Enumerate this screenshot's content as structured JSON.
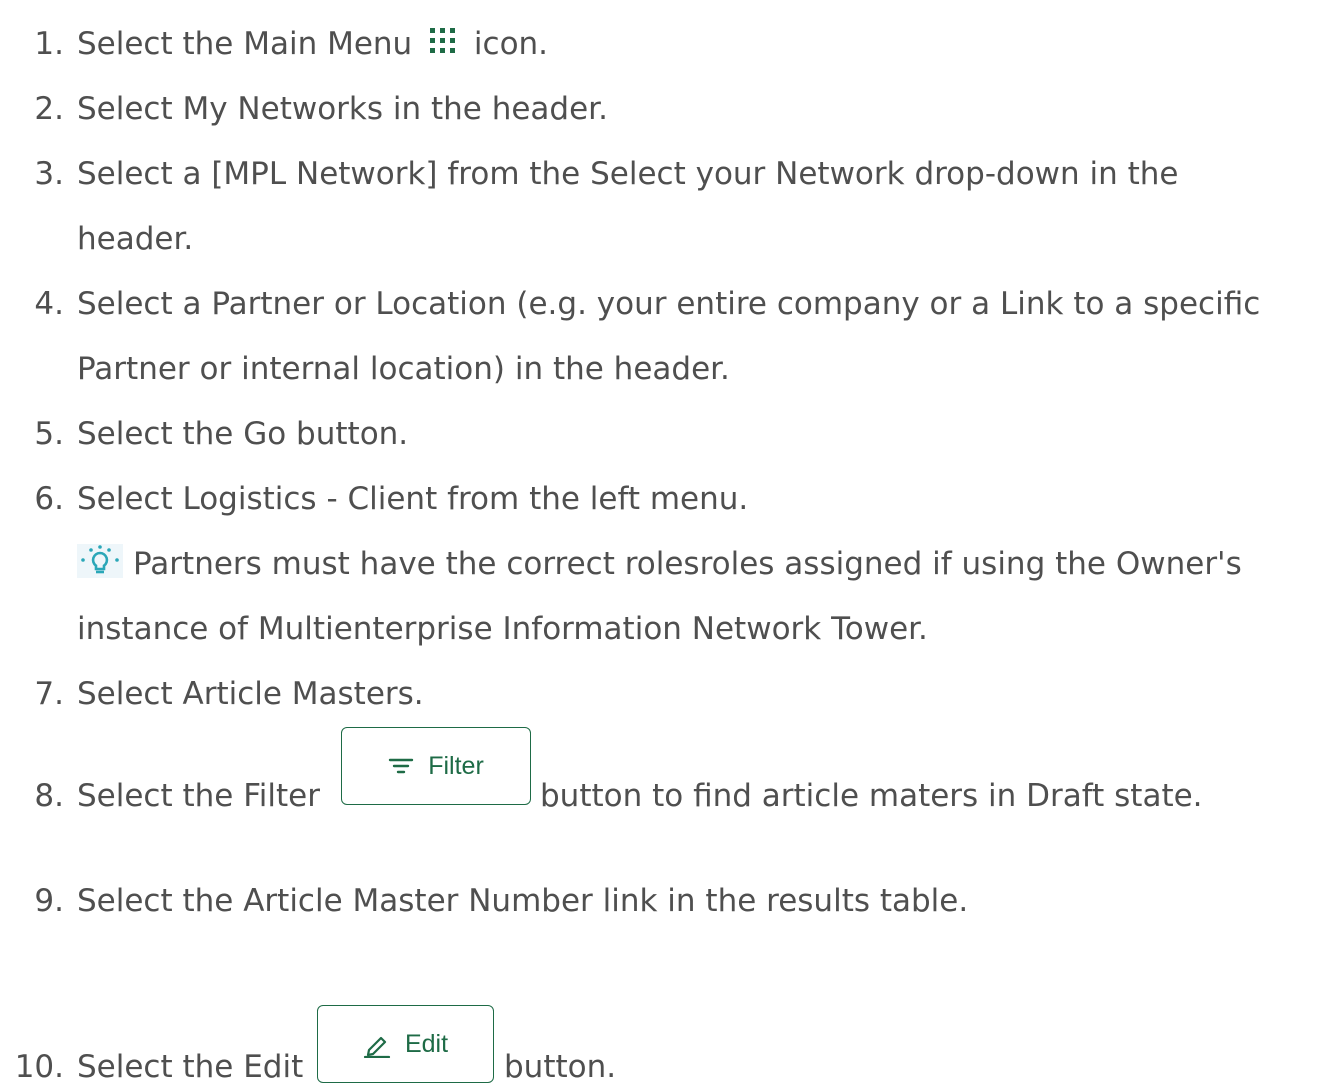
{
  "steps": [
    {
      "number": "1.",
      "before": "Select the Main Menu",
      "after": "icon.",
      "icon": "grid-dots-icon"
    },
    {
      "number": "2.",
      "text": "Select My Networks in the header."
    },
    {
      "number": "3.",
      "line1": "Select a [MPL Network] from the Select your Network drop-down in the",
      "line2": "header."
    },
    {
      "number": "4.",
      "line1": "Select a Partner or Location (e.g. your entire company or a Link to a specific",
      "line2": "Partner or internal location) in the header."
    },
    {
      "number": "5.",
      "text": "Select the Go button."
    },
    {
      "number": "6.",
      "text": " Select Logistics - Client from the left menu."
    },
    {
      "number": "7.",
      "text": "Select Article Masters."
    },
    {
      "number": "8.",
      "before": "Select the Filter",
      "after": "button to find article maters in Draft state.",
      "button_label": "Filter",
      "button_icon": "filter-lines-icon"
    },
    {
      "number": "9.",
      "text": "Select the Article Master Number link in the results table."
    },
    {
      "number": "10.",
      "before": "Select the Edit",
      "after": "button.",
      "button_label": "Edit",
      "button_icon": "pencil-icon"
    }
  ],
  "tip": {
    "icon": "lightbulb-icon",
    "line1": "Partners must have the correct rolesroles assigned if using the Owner's",
    "line2": "instance of Multienterprise Information Network Tower."
  },
  "colors": {
    "text": "#4f4f4f",
    "accent": "#1e6b46",
    "tip_icon": "#2aa7b8"
  }
}
